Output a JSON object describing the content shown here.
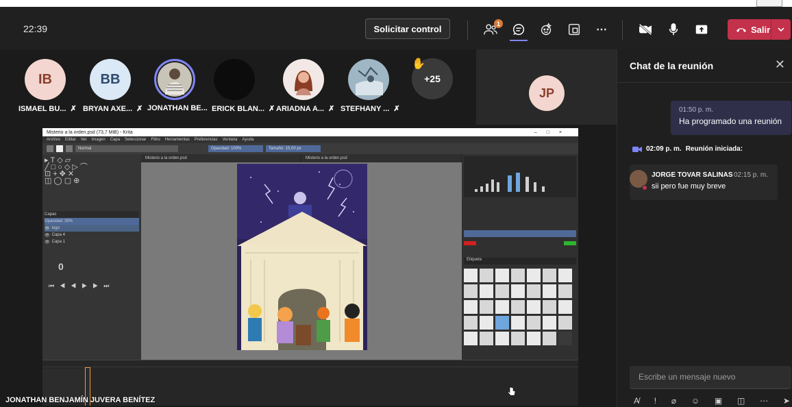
{
  "header": {
    "time": "22:39",
    "request_control": "Solicitar control",
    "participants_badge": "1",
    "leave_label": "Salir"
  },
  "participants": [
    {
      "initials": "IB",
      "name": "ISMAEL BU...",
      "bg": "#f3d6cf",
      "fg": "#8a3f2b"
    },
    {
      "initials": "BB",
      "name": "BRYAN AXE...",
      "bg": "#dbe8f6",
      "fg": "#2e4a6e"
    },
    {
      "initials": "",
      "name": "JONATHAN BE...",
      "bg": "#c9c4b8",
      "fg": "#333"
    },
    {
      "initials": "",
      "name": "ERICK BLAN...",
      "bg": "#0c0c0c",
      "fg": "#fff"
    },
    {
      "initials": "",
      "name": "ARIADNA A...",
      "bg": "#d89a7d",
      "fg": "#fff"
    },
    {
      "initials": "",
      "name": "STEFHANY ...",
      "bg": "#9fb6c4",
      "fg": "#fff"
    }
  ],
  "more_count": "+25",
  "side_tile": {
    "initials": "JP"
  },
  "presenter_name": "JONATHAN BENJAMÍN JUVERA BENÍTEZ",
  "krita": {
    "title": "Misterio a la orden.psd (73,7 MiB) - Krita",
    "menu": [
      "Archivo",
      "Editar",
      "Ver",
      "Imagen",
      "Capa",
      "Seleccionar",
      "Filtro",
      "Herramientas",
      "Preferencias",
      "Ventana",
      "Ayuda"
    ],
    "mode": "Normal",
    "opacity": "Opacidad: 100%",
    "size": "Tamaño: 15,00 px",
    "tabs": [
      "Misterio a la orden.psd",
      "Misterio a la orden.psd"
    ],
    "layers": [
      "logo",
      "Capa 4",
      "Capa 1"
    ],
    "layer_opacity": "Opacidad: 39%",
    "frame": "0",
    "brush_preset": "Etiqueta"
  },
  "chat": {
    "title": "Chat de la reunión",
    "self_time": "01:50 p. m.",
    "self_text": "Ha programado una reunión",
    "event_time": "02:09 p. m.",
    "event_text": "Reunión iniciada:",
    "sender": "JORGE TOVAR SALINAS",
    "sender_time": "02:15 p. m.",
    "sender_text": "sii pero fue muy breve",
    "compose_placeholder": "Escribe un mensaje nuevo"
  },
  "colors": {
    "accent": "#7f85f5",
    "leave": "#c4314b",
    "bubble_self": "#2f2f4a"
  }
}
